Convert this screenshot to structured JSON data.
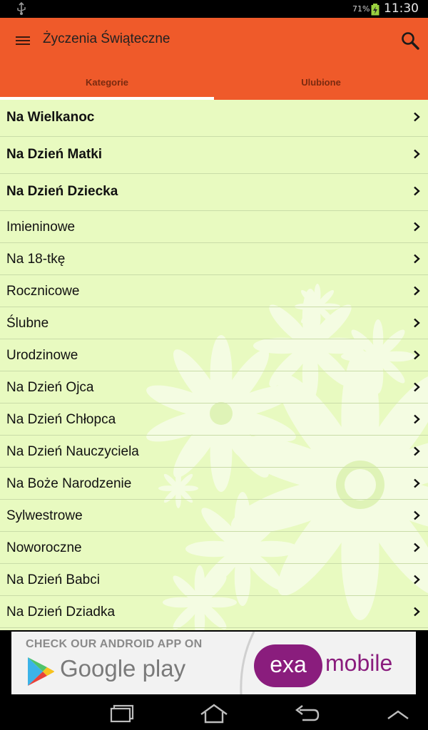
{
  "status_bar": {
    "battery_percent": "71%",
    "time": "11:30",
    "icons": [
      "usb-icon",
      "battery-charging-icon"
    ]
  },
  "app_bar": {
    "title": "Życzenia Świąteczne",
    "icons": [
      "menu-icon",
      "search-icon"
    ],
    "accent_color": "#ef5a2a",
    "tabs": [
      {
        "label": "Kategorie",
        "selected": true
      },
      {
        "label": "Ulubione",
        "selected": false
      }
    ]
  },
  "categories": [
    {
      "label": "Na Wielkanoc",
      "bold": true
    },
    {
      "label": "Na Dzień Matki",
      "bold": true
    },
    {
      "label": "Na Dzień Dziecka",
      "bold": true
    },
    {
      "label": "Imieninowe",
      "bold": false
    },
    {
      "label": "Na 18-tkę",
      "bold": false
    },
    {
      "label": "Rocznicowe",
      "bold": false
    },
    {
      "label": "Ślubne",
      "bold": false
    },
    {
      "label": "Urodzinowe",
      "bold": false
    },
    {
      "label": "Na Dzień Ojca",
      "bold": false
    },
    {
      "label": "Na Dzień Chłopca",
      "bold": false
    },
    {
      "label": "Na Dzień Nauczyciela",
      "bold": false
    },
    {
      "label": "Na Boże Narodzenie",
      "bold": false
    },
    {
      "label": "Sylwestrowe",
      "bold": false
    },
    {
      "label": "Noworoczne",
      "bold": false
    },
    {
      "label": "Na Dzień Babci",
      "bold": false
    },
    {
      "label": "Na Dzień Dziadka",
      "bold": false
    }
  ],
  "list_background": "#e8fac0",
  "ad": {
    "headline": "CHECK OUR ANDROID APP ON",
    "store_name": "Google play",
    "brand_badge": "exa",
    "brand_rest": "mobile",
    "brand_color": "#8a1d7d"
  },
  "nav_bar": {
    "icons": [
      "recent-apps-icon",
      "home-icon",
      "back-icon",
      "chevron-up-icon"
    ]
  }
}
